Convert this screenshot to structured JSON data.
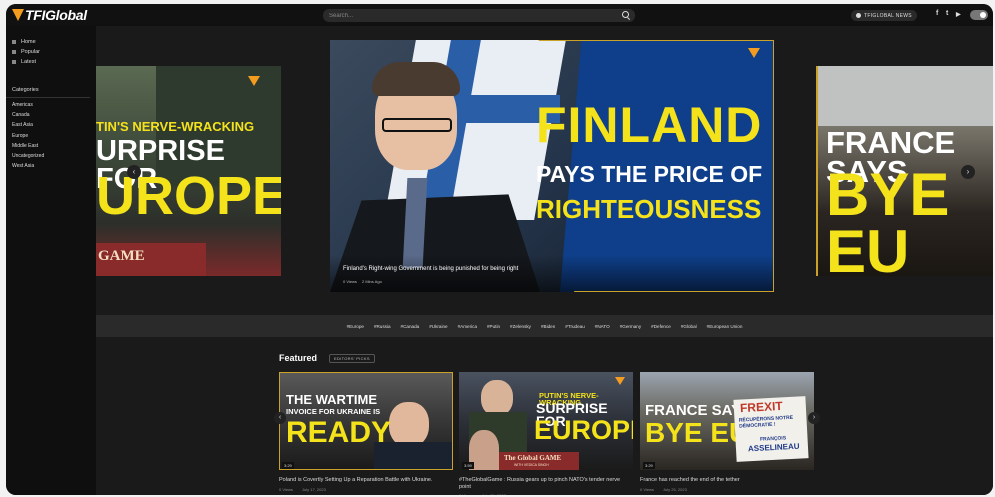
{
  "header": {
    "logo_text": "TFIGlobal",
    "search_placeholder": "Search...",
    "brand_pill": "TFIGLOBAL NEWS",
    "social": [
      "f",
      "t",
      "▶"
    ]
  },
  "sidebar": {
    "nav": [
      {
        "label": "Home",
        "icon": "home-icon"
      },
      {
        "label": "Popular",
        "icon": "fire-icon"
      },
      {
        "label": "Latest",
        "icon": "bolt-icon"
      }
    ],
    "categories_title": "Categories",
    "categories": [
      "Americas",
      "Canada",
      "East Asia",
      "Europe",
      "Middle East",
      "Uncategorized",
      "West Asia"
    ]
  },
  "hero": {
    "left": {
      "lines": [
        "TIN'S NERVE-WRACKING",
        "URPRISE FOR",
        "UROPE"
      ],
      "badge": "GAME"
    },
    "center": {
      "lines": [
        "FINLAND",
        "PAYS THE PRICE OF",
        "RIGHTEOUSNESS"
      ],
      "caption": "Finland's Right-wing Government is being punished for being right",
      "views": "0 Views",
      "age": "2 Mins Ago"
    },
    "right": {
      "lines": [
        "FRANCE SAYS",
        "BYE EU"
      ]
    }
  },
  "tags": [
    "#Europe",
    "#Russia",
    "#Canada",
    "#Ukraine",
    "#America",
    "#Putin",
    "#Zelensky",
    "#Biden",
    "#Trudeau",
    "#NATO",
    "#Germany",
    "#Defence",
    "#Global",
    "#European Union"
  ],
  "featured": {
    "title": "Featured",
    "pill": "EDITORS' PICKS",
    "cards": [
      {
        "lines": [
          "THE WARTIME",
          "INVOICE FOR UKRAINE IS",
          "READY"
        ],
        "duration": "3:29",
        "title": "Poland is Covertly Setting Up a Reparation Battle with Ukraine.",
        "views": "0 Views",
        "date": "July 17, 2023"
      },
      {
        "lines": [
          "PUTIN'S NERVE-WRACKING",
          "SURPRISE FOR",
          "EUROPE"
        ],
        "badge": "The Global GAME",
        "badge_sub": "WITH VEDICA SINGH",
        "duration": "3:59",
        "title": "#TheGlobalGame : Russia gears up to pinch NATO's tender nerve point",
        "views": "0 Views",
        "date": "July 25, 2023"
      },
      {
        "lines": [
          "FRANCE SAYS",
          "BYE EU"
        ],
        "sign": [
          "FREXIT",
          "RÉCUPÉRONS NOTRE DÉMOCRATIE !"
        ],
        "sign_sub": [
          "FRANÇOIS",
          "ASSELINEAU"
        ],
        "duration": "3:29",
        "title": "France has reached the end of the tether",
        "views": "0 Views",
        "date": "July 25, 2023"
      }
    ]
  },
  "colors": {
    "accent": "#f39c1f",
    "headline_yellow": "#f4e21a",
    "bg": "#1a1a1a"
  }
}
